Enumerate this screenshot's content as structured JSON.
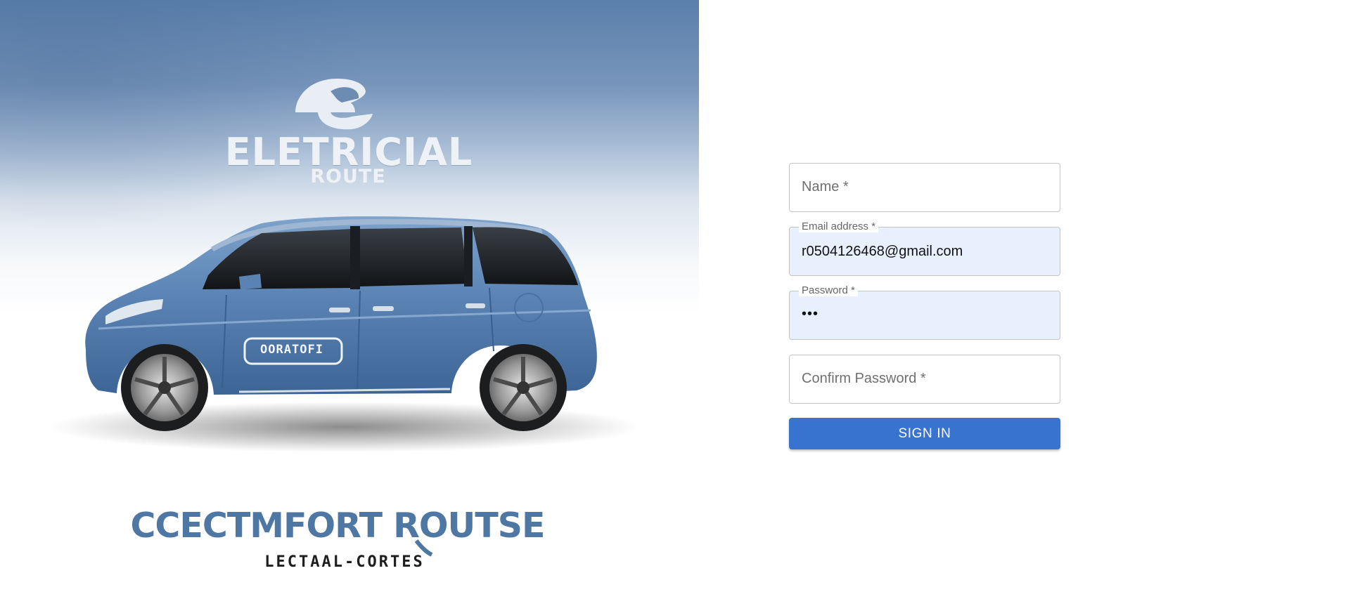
{
  "hero": {
    "image_name": "electric-car-illustration",
    "brand_title": "ELETRICIAL",
    "brand_subtitle": "ROUTE",
    "door_text": "OORATOFI",
    "footer_title": "CCECTMFORT ROUTSE",
    "footer_subtitle": "LECTAAL-CORTES",
    "colors": {
      "car_body": "#5f87b7",
      "sky": "#5a7fab",
      "footer_title": "#4f77a3"
    }
  },
  "form": {
    "name": {
      "placeholder": "Name *",
      "value": ""
    },
    "email": {
      "label": "Email address *",
      "value": "r0504126468@gmail.com"
    },
    "password": {
      "label": "Password *",
      "value": "•••"
    },
    "confirm_password": {
      "placeholder": "Confirm Password *",
      "value": ""
    },
    "submit_label": "SIGN IN",
    "colors": {
      "button": "#3874cf",
      "autofill_bg": "#e8f0fe"
    }
  }
}
